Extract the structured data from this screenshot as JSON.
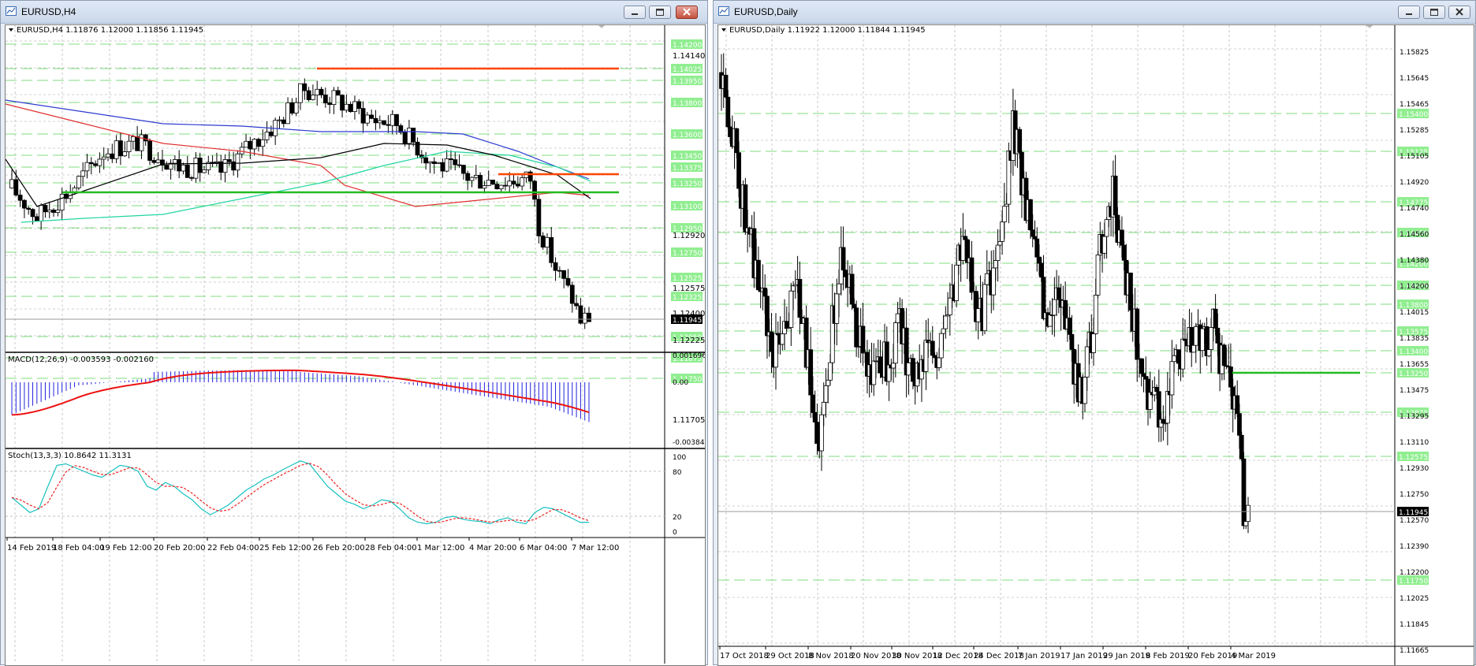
{
  "windows": {
    "h4": {
      "title": "EURUSD,H4",
      "info": "EURUSD,H4  1.11876 1.12000 1.11856 1.11945",
      "price_labels": [
        "1.14140",
        "1.12920",
        "1.12575",
        "1.12400",
        "1.12225",
        "1.11705"
      ],
      "level_labels": [
        "1.14200",
        "1.14025",
        "1.13950",
        "1.13800",
        "1.13600",
        "1.13450",
        "1.13375",
        "1.13250",
        "1.13100",
        "1.12950",
        "1.12750",
        "1.12525",
        "1.12325",
        "1.12050",
        "1.11875",
        "1.11750"
      ],
      "current_price": "1.11945",
      "macd": {
        "label": "MACD(12,26,9) -0.003593 -0.002160",
        "scale": [
          "0.001696",
          "0.00",
          "-0.003845"
        ]
      },
      "stoch": {
        "label": "Stoch(13,3,3) 10.8642 11.3131",
        "scale": [
          "100",
          "80",
          "20",
          "0"
        ]
      },
      "x_labels": [
        "14 Feb 2019",
        "18 Feb 04:00",
        "19 Feb 12:00",
        "20 Feb 20:00",
        "22 Feb 04:00",
        "25 Feb 12:00",
        "26 Feb 20:00",
        "28 Feb 04:00",
        "1 Mar 12:00",
        "4 Mar 20:00",
        "6 Mar 04:00",
        "7 Mar 12:00"
      ]
    },
    "daily": {
      "title": "EURUSD,Daily",
      "info": "EURUSD,Daily  1.11922 1.12000 1.11844 1.11945",
      "price_labels": [
        "1.15825",
        "1.15645",
        "1.15465",
        "1.15285",
        "1.15105",
        "1.14920",
        "1.14740",
        "1.14560",
        "1.14380",
        "1.14200",
        "1.14015",
        "1.13835",
        "1.13655",
        "1.13475",
        "1.13295",
        "1.13110",
        "1.12930",
        "1.12750",
        "1.12570",
        "1.12390",
        "1.12200",
        "1.12025",
        "1.11845",
        "1.11665"
      ],
      "level_labels": [
        "1.15400",
        "1.15125",
        "1.14775",
        "1.14450",
        "1.14200",
        "1.14025",
        "1.13800",
        "1.13575",
        "1.13400",
        "1.13250",
        "1.12875",
        "1.12575",
        "1.12150",
        "1.11750"
      ],
      "current_price": "1.11945",
      "x_labels": [
        "17 Oct 2018",
        "29 Oct 2018",
        "8 Nov 2018",
        "20 Nov 2018",
        "30 Nov 2018",
        "12 Dec 2018",
        "24 Dec 2018",
        "7 Jan 2019",
        "17 Jan 2019",
        "29 Jan 2019",
        "8 Feb 2019",
        "20 Feb 2019",
        "4 Mar 2019"
      ]
    }
  },
  "colors": {
    "bull_fill": "#ffffff",
    "bear_fill": "#000000",
    "level_line": "#7fdc7f",
    "level_label_bg": "#90ee90",
    "support_line": "#22bb22",
    "resistance_line": "#ff4500",
    "ma_fast": "#000000",
    "ma_mid": "#2d3bd0",
    "ma_slow": "#e03030",
    "ma_teal": "#20d6a0",
    "macd_hist": "#2222dd",
    "macd_signal": "#ee1111",
    "stoch_main": "#18c0c0",
    "stoch_signal": "#ee2222",
    "current_label_bg": "#000000"
  }
}
